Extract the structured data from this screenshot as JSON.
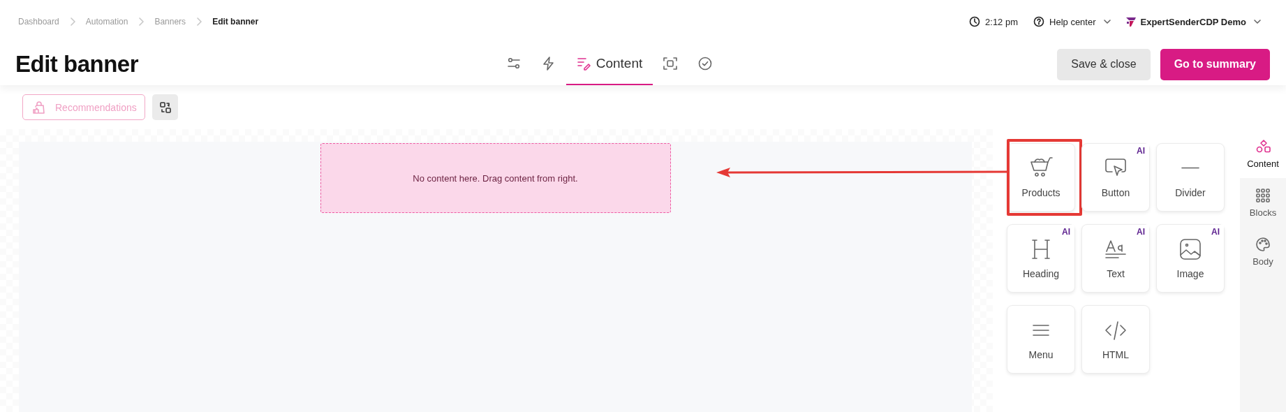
{
  "breadcrumb": [
    {
      "label": "Dashboard",
      "current": false
    },
    {
      "label": "Automation",
      "current": false
    },
    {
      "label": "Banners",
      "current": false
    },
    {
      "label": "Edit banner",
      "current": true
    }
  ],
  "header": {
    "title": "Edit banner",
    "time": "2:12 pm",
    "help": "Help center",
    "account": "ExpertSenderCDP Demo"
  },
  "steps": [
    {
      "selected": false
    },
    {
      "selected": false
    },
    {
      "label": "Content",
      "selected": true
    },
    {
      "selected": false
    },
    {
      "selected": false
    }
  ],
  "actions": [
    {
      "label": "Save & close",
      "kind": "secondary"
    },
    {
      "label": "Go to summary",
      "kind": "primary"
    }
  ],
  "toolbar": {
    "recommendations": {
      "label": "Recommendations",
      "disabled": true
    }
  },
  "canvas": {
    "empty_message": "No content here. Drag content from right."
  },
  "palette": [
    {
      "label": "Products",
      "highlighted": true
    },
    {
      "label": "Button",
      "badge": "AI",
      "highlighted": false
    },
    {
      "label": "Divider",
      "highlighted": false
    },
    {
      "label": "Heading",
      "badge": "AI",
      "highlighted": false
    },
    {
      "label": "Text",
      "badge": "AI",
      "highlighted": false
    },
    {
      "label": "Image",
      "badge": "AI",
      "highlighted": false
    },
    {
      "label": "Menu",
      "highlighted": false
    },
    {
      "label": "HTML",
      "highlighted": false
    }
  ],
  "side_tabs": [
    {
      "label": "Content",
      "selected": true
    },
    {
      "label": "Blocks",
      "selected": false
    },
    {
      "label": "Body",
      "selected": false
    }
  ]
}
